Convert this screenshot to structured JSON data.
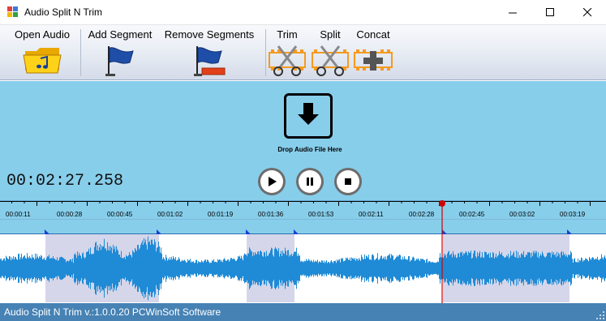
{
  "window": {
    "title": "Audio Split N Trim",
    "controls": [
      "minimize-icon",
      "maximize-icon",
      "close-icon"
    ]
  },
  "toolbar": {
    "open_audio": "Open Audio",
    "add_segment": "Add Segment",
    "remove_segments": "Remove Segments",
    "trim": "Trim",
    "split": "Split",
    "concat": "Concat"
  },
  "main": {
    "drop_label": "Drop Audio File Here",
    "time": "00:02:27.258"
  },
  "timeline": {
    "ticks": [
      "00:00:11",
      "00:00:28",
      "00:00:45",
      "00:01:02",
      "00:01:19",
      "00:01:36",
      "00:01:53",
      "00:02:11",
      "00:02:28",
      "00:02:45",
      "00:03:02",
      "00:03:19"
    ]
  },
  "status": {
    "text": "Audio Split N Trim v.:1.0.0.20 PCWinSoft Software"
  },
  "colors": {
    "main_bg": "#87ceeb",
    "status_bg": "#4682b4",
    "waveform": "#1f8bd6",
    "segment": "#d5d6ea",
    "playhead": "#d00000"
  }
}
